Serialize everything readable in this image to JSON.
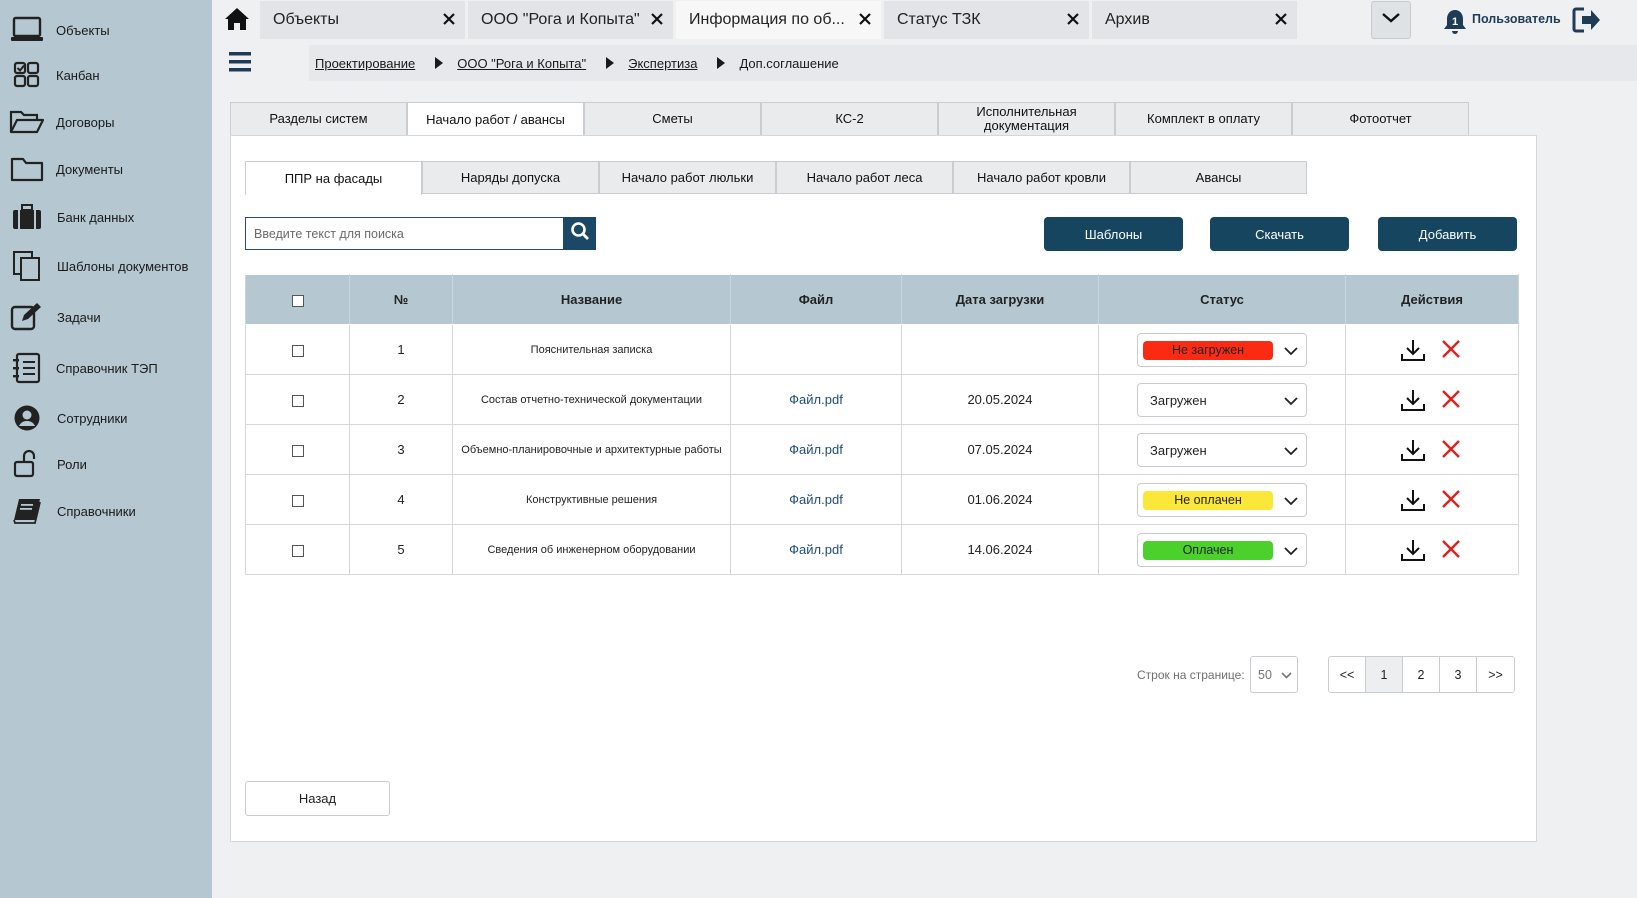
{
  "sidebar": {
    "items": [
      {
        "label": "Объекты",
        "icon": "laptop-icon"
      },
      {
        "label": "Канбан",
        "icon": "kanban-icon"
      },
      {
        "label": "Договоры",
        "icon": "folder-open-icon"
      },
      {
        "label": "Документы",
        "icon": "folder-icon"
      },
      {
        "label": "Банк данных",
        "icon": "briefcase-icon"
      },
      {
        "label": "Шаблоны документов",
        "icon": "copy-icon"
      },
      {
        "label": "Задачи",
        "icon": "edit-icon"
      },
      {
        "label": "Справочник ТЭП",
        "icon": "list-icon"
      },
      {
        "label": "Сотрудники",
        "icon": "user-circle-icon"
      },
      {
        "label": "Роли",
        "icon": "unlock-icon"
      },
      {
        "label": "Справочники",
        "icon": "book-icon"
      }
    ]
  },
  "top_tabs": [
    {
      "label": "Объекты"
    },
    {
      "label": "ООО \"Рога и Копыта\""
    },
    {
      "label": "Информация по об..."
    },
    {
      "label": "Статус ТЗК"
    },
    {
      "label": "Архив"
    }
  ],
  "header": {
    "notification_count": "1",
    "user_label": "Пользователь"
  },
  "breadcrumb": [
    "Проектирование",
    "ООО \"Рога и Копыта\"",
    "Экспертиза",
    "Доп.соглашение"
  ],
  "main_tabs": [
    {
      "label": "Разделы систем"
    },
    {
      "label": "Начало работ / авансы"
    },
    {
      "label": "Сметы"
    },
    {
      "label": "КС-2"
    },
    {
      "label": "Исполнительная документация"
    },
    {
      "label": "Комплект в оплату"
    },
    {
      "label": "Фотоотчет"
    }
  ],
  "sub_tabs": [
    {
      "label": "ППР на фасады"
    },
    {
      "label": "Наряды допуска"
    },
    {
      "label": "Начало работ люльки"
    },
    {
      "label": "Начало работ леса"
    },
    {
      "label": "Начало работ кровли"
    },
    {
      "label": "Авансы"
    }
  ],
  "search": {
    "placeholder": "Введите текст для поиска",
    "value": ""
  },
  "actions": {
    "templates": "Шаблоны",
    "download": "Скачать",
    "add": "Добавить"
  },
  "table": {
    "headers": {
      "num": "№",
      "name": "Название",
      "file": "Файл",
      "date": "Дата загрузки",
      "status": "Статус",
      "actions": "Действия"
    },
    "rows": [
      {
        "num": "1",
        "name": "Пояснительная записка",
        "file": "",
        "date": "",
        "status": "Не загружен",
        "status_color": "#fb2a12"
      },
      {
        "num": "2",
        "name": "Состав отчетно-технической документации",
        "file": "Файл.pdf",
        "date": "20.05.2024",
        "status": "Загружен",
        "status_color": ""
      },
      {
        "num": "3",
        "name": "Объемно-планировочные и архитектурные работы",
        "file": "Файл.pdf",
        "date": "07.05.2024",
        "status": "Загружен",
        "status_color": ""
      },
      {
        "num": "4",
        "name": "Конструктивные решения",
        "file": "Файл.pdf",
        "date": "01.06.2024",
        "status": "Не оплачен",
        "status_color": "#fbe73a"
      },
      {
        "num": "5",
        "name": "Сведения об инженерном оборудовании",
        "file": "Файл.pdf",
        "date": "14.06.2024",
        "status": "Оплачен",
        "status_color": "#4cd02c"
      }
    ]
  },
  "pagination": {
    "rows_label": "Строк на странице:",
    "rows_value": "50",
    "prev": "<<",
    "pages": [
      "1",
      "2",
      "3"
    ],
    "next": ">>"
  },
  "back_label": "Назад",
  "colors": {
    "sidebar": "#b5c8d1",
    "accent": "#15455f",
    "header_row": "#b5c8d1"
  }
}
